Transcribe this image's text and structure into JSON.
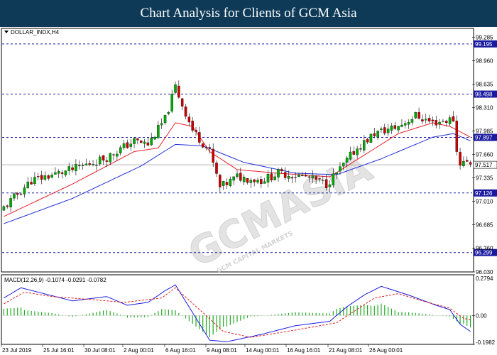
{
  "banner": {
    "title": "Chart Analysis for Clients of GCM Asia"
  },
  "watermark": {
    "text": "GCMASIA",
    "sub": "GCM CAPITAL MARKETS"
  },
  "colors": {
    "banner_bg": "#0e3a57",
    "bull": "#00aa00",
    "bear": "#cc0000",
    "ma_fast": "#e8202a",
    "ma_slow": "#2230d8",
    "level": "#1a1aa0",
    "macd_line": "#1a1ae0",
    "macd_signal": "#e02020",
    "macd_hist": "#22aa22"
  },
  "chart_data": [
    {
      "type": "candlestick",
      "symbol_label": "DOLLAR_INDX,H4",
      "ylim": [
        96.03,
        99.41
      ],
      "y_ticks": [
        "99.285",
        "98.960",
        "98.635",
        "98.310",
        "97.985",
        "97.660",
        "97.335",
        "97.010",
        "96.685",
        "96.360",
        "96.030"
      ],
      "x_ticks": [
        "23 Jul 2019",
        "25 Jul 16:01",
        "30 Jul 08:01",
        "2 Aug 00:01",
        "6 Aug 16:01",
        "9 Aug 08:01",
        "14 Aug 00:01",
        "16 Aug 16:01",
        "21 Aug 08:01",
        "26 Aug 00:01"
      ],
      "levels": [
        "99.195",
        "98.498",
        "97.897",
        "97.126",
        "96.299"
      ],
      "current_price": "97.517",
      "close_path": [
        [
          0,
          96.92
        ],
        [
          8,
          97.3
        ],
        [
          20,
          97.45
        ],
        [
          30,
          97.62
        ],
        [
          38,
          97.85
        ],
        [
          42,
          97.8
        ],
        [
          47,
          98.15
        ],
        [
          50,
          98.6
        ],
        [
          52,
          98.35
        ],
        [
          55,
          98.0
        ],
        [
          60,
          97.7
        ],
        [
          63,
          97.2
        ],
        [
          68,
          97.35
        ],
        [
          75,
          97.3
        ],
        [
          80,
          97.4
        ],
        [
          88,
          97.35
        ],
        [
          94,
          97.25
        ],
        [
          98,
          97.45
        ],
        [
          102,
          97.7
        ],
        [
          108,
          97.95
        ],
        [
          115,
          98.05
        ],
        [
          120,
          98.2
        ],
        [
          125,
          98.1
        ],
        [
          131,
          98.15
        ],
        [
          132,
          97.7
        ],
        [
          133,
          97.55
        ],
        [
          136,
          97.55
        ]
      ],
      "ma_fast_path": [
        [
          0,
          96.8
        ],
        [
          20,
          97.25
        ],
        [
          38,
          97.7
        ],
        [
          45,
          97.75
        ],
        [
          50,
          98.1
        ],
        [
          55,
          98.05
        ],
        [
          60,
          97.7
        ],
        [
          68,
          97.45
        ],
        [
          80,
          97.4
        ],
        [
          95,
          97.35
        ],
        [
          105,
          97.65
        ],
        [
          115,
          97.95
        ],
        [
          125,
          98.1
        ],
        [
          130,
          98.05
        ],
        [
          136,
          97.9
        ]
      ],
      "ma_slow_path": [
        [
          0,
          96.7
        ],
        [
          20,
          97.05
        ],
        [
          40,
          97.5
        ],
        [
          50,
          97.8
        ],
        [
          58,
          97.78
        ],
        [
          70,
          97.55
        ],
        [
          85,
          97.4
        ],
        [
          97,
          97.38
        ],
        [
          110,
          97.6
        ],
        [
          125,
          97.9
        ],
        [
          131,
          97.95
        ],
        [
          136,
          97.85
        ]
      ]
    },
    {
      "type": "macd",
      "label": "MACD(12,26,9) -0.1074 -0.0291 -0.0782",
      "ylim": [
        -0.1982,
        0.2794
      ],
      "y_ticks": [
        "0.2794",
        "0.00",
        "-0.1982"
      ],
      "macd_path": [
        [
          0,
          0.12
        ],
        [
          5,
          0.19
        ],
        [
          10,
          0.16
        ],
        [
          20,
          0.1
        ],
        [
          30,
          0.13
        ],
        [
          36,
          0.07
        ],
        [
          42,
          0.09
        ],
        [
          47,
          0.17
        ],
        [
          50,
          0.21
        ],
        [
          55,
          0.02
        ],
        [
          60,
          -0.17
        ],
        [
          65,
          -0.18
        ],
        [
          75,
          -0.13
        ],
        [
          85,
          -0.07
        ],
        [
          95,
          -0.04
        ],
        [
          100,
          0.06
        ],
        [
          105,
          0.14
        ],
        [
          110,
          0.2
        ],
        [
          118,
          0.14
        ],
        [
          126,
          0.07
        ],
        [
          130,
          0.04
        ],
        [
          133,
          -0.06
        ],
        [
          136,
          -0.11
        ]
      ],
      "signal_path": [
        [
          0,
          0.08
        ],
        [
          6,
          0.16
        ],
        [
          14,
          0.13
        ],
        [
          25,
          0.11
        ],
        [
          35,
          0.09
        ],
        [
          46,
          0.12
        ],
        [
          50,
          0.19
        ],
        [
          58,
          0.02
        ],
        [
          64,
          -0.11
        ],
        [
          72,
          -0.15
        ],
        [
          85,
          -0.1
        ],
        [
          97,
          -0.05
        ],
        [
          108,
          0.12
        ],
        [
          115,
          0.15
        ],
        [
          122,
          0.1
        ],
        [
          130,
          0.05
        ],
        [
          134,
          -0.02
        ],
        [
          136,
          -0.03
        ]
      ]
    }
  ]
}
